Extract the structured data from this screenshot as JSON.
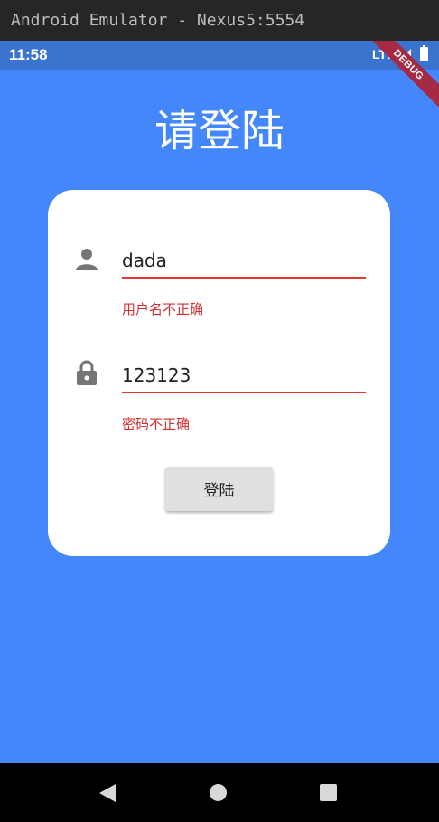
{
  "window": {
    "title": "Android Emulator - Nexus5:5554"
  },
  "status_bar": {
    "time": "11:58",
    "network": "LTE",
    "debug_banner": "DEBUG"
  },
  "page": {
    "title": "请登陆"
  },
  "form": {
    "username": {
      "value": "dada",
      "error": "用户名不正确",
      "icon": "person-icon"
    },
    "password": {
      "value": "123123",
      "error": "密码不正确",
      "icon": "lock-icon"
    },
    "submit_label": "登陆"
  },
  "colors": {
    "background": "#4387fb",
    "status_bar": "#3a74cf",
    "error": "#d32f2f",
    "card": "#ffffff",
    "button": "#e0e0e0"
  },
  "nav_bar": {
    "icons": [
      "back-icon",
      "home-icon",
      "recents-icon"
    ]
  }
}
